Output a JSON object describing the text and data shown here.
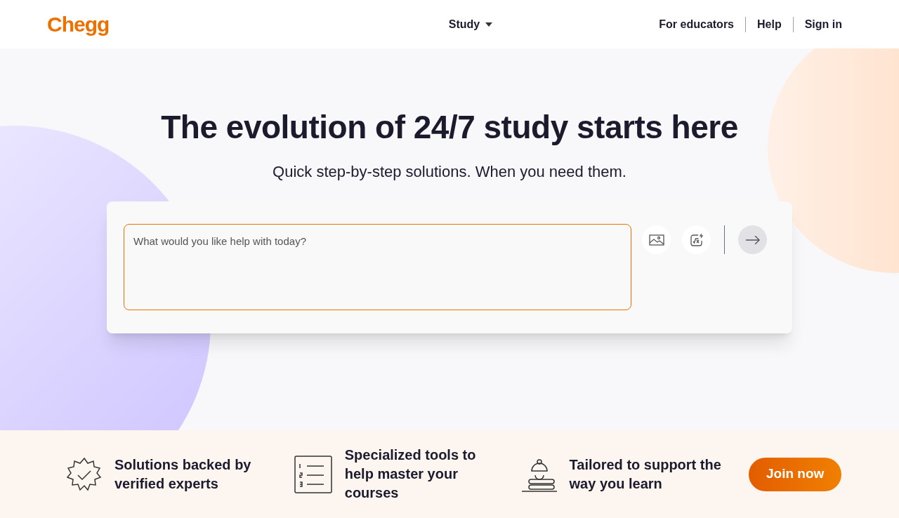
{
  "header": {
    "logo": "Chegg",
    "nav": [
      {
        "label": "Study",
        "dropdown": true
      }
    ],
    "links": [
      "For educators",
      "Help",
      "Sign in"
    ]
  },
  "hero": {
    "title": "The evolution of 24/7 study starts here",
    "subtitle": "Quick step-by-step solutions. When you need them.",
    "search": {
      "placeholder": "What would you like help with today?"
    }
  },
  "features": [
    {
      "kind": "badge",
      "text": "Solutions backed by verified experts"
    },
    {
      "kind": "list",
      "text": "Specialized tools to help master your courses"
    },
    {
      "kind": "lamp",
      "text": "Tailored to support the way you learn"
    }
  ],
  "cta": "Join now"
}
